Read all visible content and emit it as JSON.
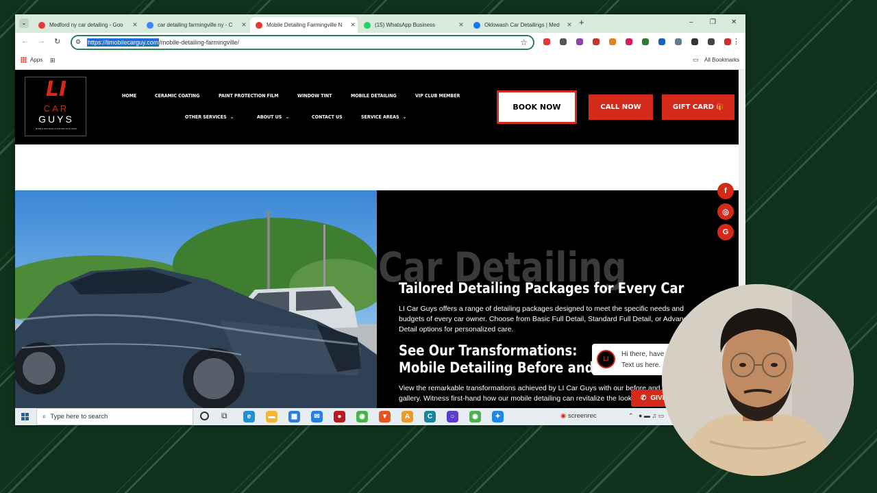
{
  "browser": {
    "tabs": [
      {
        "title": "Medford ny car detailing - Goo",
        "active": false
      },
      {
        "title": "car detailing farmingville ny - C",
        "active": false
      },
      {
        "title": "Mobile Detailing Farmingville N",
        "active": true
      },
      {
        "title": "(15) WhatsApp Business",
        "active": false
      },
      {
        "title": "Oklowash Car Detailings | Med",
        "active": false
      }
    ],
    "new_tab": "+",
    "window_controls": {
      "minimize": "–",
      "restore": "❐",
      "close": "✕"
    },
    "url_highlight": "https://limobilecarguy.com",
    "url_rest": "/mobile-detailing-farmingville/",
    "bookmarks": {
      "apps": "Apps",
      "all": "All Bookmarks"
    },
    "extension_colors": [
      "#e53935",
      "#555555",
      "#8e44ad",
      "#c0392b",
      "#e67e22",
      "#d81b60",
      "#2e7d32",
      "#1565c0",
      "#607d8b",
      "#333333",
      "#444444",
      "#d32f2f"
    ]
  },
  "site": {
    "logo": {
      "big": "LI",
      "line1": "CAR",
      "line2": "GUYS",
      "tag": "MOBILE DETAILING & PROTECTION SHOP"
    },
    "nav_row1": [
      "HOME",
      "CERAMIC COATING",
      "PAINT PROTECTION FILM",
      "WINDOW TINT",
      "MOBILE DETAILING",
      "VIP CLUB MEMBER"
    ],
    "nav_row2": [
      "OTHER SERVICES",
      "ABOUT US",
      "CONTACT US",
      "SERVICE AREAS"
    ],
    "chevron": "⌄",
    "book_now": "BOOK NOW",
    "call_now": "CALL NOW",
    "gift_card": "GIFT CARD",
    "gift_icon": "🎁",
    "social": [
      {
        "icon": "facebook-icon",
        "glyph": "f"
      },
      {
        "icon": "instagram-icon",
        "glyph": "◎"
      },
      {
        "icon": "google-icon",
        "glyph": "G"
      }
    ],
    "hero": {
      "bg_text": "Car Detailing",
      "heading1": "Tailored Detailing Packages for Every Car",
      "para1": "LI Car Guys offers a range of detailing packages designed to meet the specific needs and budgets of every car owner. Choose from Basic Full Detail, Standard Full Detail, or Advanced Detail options for personalized care.",
      "heading2": "See Our Transformations: Mobile Detailing Before and After",
      "para2": "View the remarkable transformations achieved by LI Car Guys with our before and after gallery. Witness first-hand how our mobile detailing can revitalize the look of your vehicle."
    },
    "chat": {
      "line1": "Hi there, have a question?",
      "line2": "Text us here."
    },
    "give_button": "GIVE US A CALL",
    "colors": {
      "accent": "#d42a1a",
      "nav_bg": "#000000"
    }
  },
  "taskbar": {
    "search_placeholder": "Type here to search",
    "screenrec": "screenrec",
    "app_icons": [
      {
        "name": "edge-icon",
        "color": "#1f8fd6",
        "glyph": "e"
      },
      {
        "name": "file-explorer-icon",
        "color": "#f2b632",
        "glyph": "▬"
      },
      {
        "name": "store-icon",
        "color": "#2a7de1",
        "glyph": "▦"
      },
      {
        "name": "mail-icon",
        "color": "#2a7de1",
        "glyph": "✉"
      },
      {
        "name": "app-red-icon",
        "color": "#b71c1c",
        "glyph": "●"
      },
      {
        "name": "chrome-icon",
        "color": "#4caf50",
        "glyph": "◉"
      },
      {
        "name": "brave-icon",
        "color": "#e8541e",
        "glyph": "▼"
      },
      {
        "name": "app-a-icon",
        "color": "#e89b2f",
        "glyph": "A"
      },
      {
        "name": "app-teal-icon",
        "color": "#15869b",
        "glyph": "C"
      },
      {
        "name": "app-purple-icon",
        "color": "#5c3dc9",
        "glyph": "○"
      },
      {
        "name": "chrome-icon-2",
        "color": "#4caf50",
        "glyph": "◉"
      },
      {
        "name": "app-blue-icon",
        "color": "#1e88e5",
        "glyph": "✦"
      }
    ]
  }
}
